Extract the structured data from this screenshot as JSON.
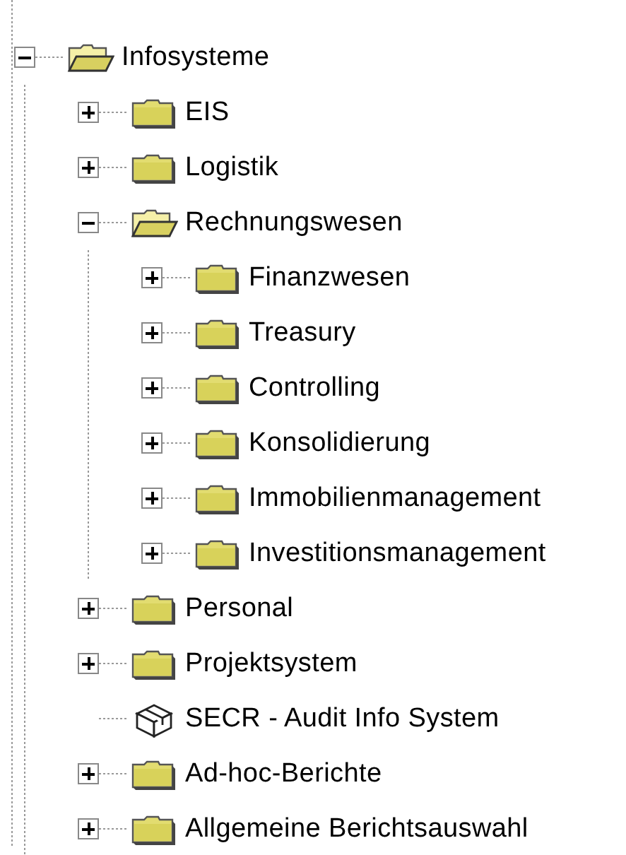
{
  "tree": [
    {
      "label": "Infosysteme",
      "kind": "folder",
      "expanded": true,
      "children": [
        {
          "label": "EIS",
          "kind": "folder",
          "expanded": false
        },
        {
          "label": "Logistik",
          "kind": "folder",
          "expanded": false
        },
        {
          "label": "Rechnungswesen",
          "kind": "folder",
          "expanded": true,
          "children": [
            {
              "label": "Finanzwesen",
              "kind": "folder",
              "expanded": false
            },
            {
              "label": "Treasury",
              "kind": "folder",
              "expanded": false
            },
            {
              "label": "Controlling",
              "kind": "folder",
              "expanded": false
            },
            {
              "label": "Konsolidierung",
              "kind": "folder",
              "expanded": false
            },
            {
              "label": "Immobilienmanagement",
              "kind": "folder",
              "expanded": false
            },
            {
              "label": "Investitionsmanagement",
              "kind": "folder",
              "expanded": false
            }
          ]
        },
        {
          "label": "Personal",
          "kind": "folder",
          "expanded": false
        },
        {
          "label": "Projektsystem",
          "kind": "folder",
          "expanded": false
        },
        {
          "label": "SECR - Audit Info System",
          "kind": "package"
        },
        {
          "label": "Ad-hoc-Berichte",
          "kind": "folder",
          "expanded": false
        },
        {
          "label": "Allgemeine Berichtsauswahl",
          "kind": "folder",
          "expanded": false
        }
      ]
    }
  ]
}
